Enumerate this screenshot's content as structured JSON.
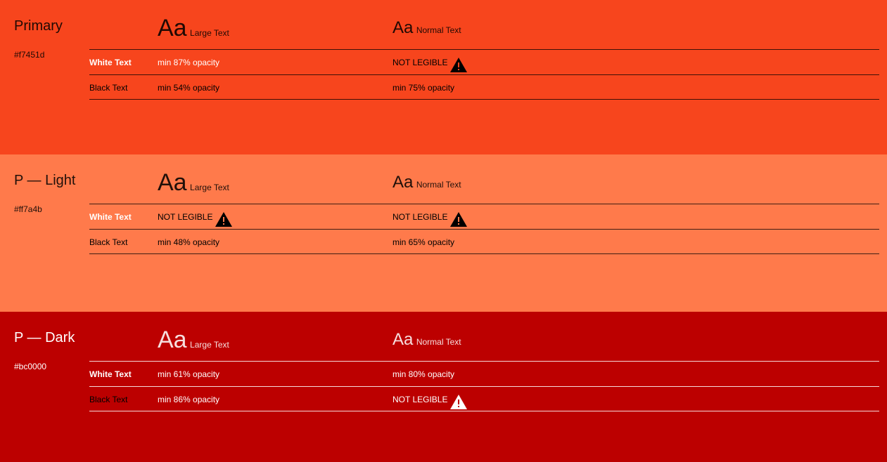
{
  "palette": [
    {
      "name": "Primary",
      "hex": "#f7451d",
      "bg": "#f7451d",
      "large_sample": "Aa",
      "large_label": "Large Text",
      "normal_sample": "Aa",
      "normal_label": "Normal Text",
      "white_row": {
        "label": "White Text",
        "large": "min 87% opacity",
        "normal": "NOT LEGIBLE",
        "normal_warn": true
      },
      "black_row": {
        "label": "Black Text",
        "large": "min 54% opacity",
        "normal": "min 75% opacity"
      }
    },
    {
      "name": "P — Light",
      "hex": "#ff7a4b",
      "bg": "#ff7a4b",
      "large_sample": "Aa",
      "large_label": "Large Text",
      "normal_sample": "Aa",
      "normal_label": "Normal Text",
      "white_row": {
        "label": "White Text",
        "large": "NOT LEGIBLE",
        "large_warn": true,
        "normal": "NOT LEGIBLE",
        "normal_warn": true
      },
      "black_row": {
        "label": "Black Text",
        "large": "min 48% opacity",
        "normal": "min 65% opacity"
      }
    },
    {
      "name": "P — Dark",
      "hex": "#bc0000",
      "bg": "#bc0000",
      "large_sample": "Aa",
      "large_label": "Large Text",
      "normal_sample": "Aa",
      "normal_label": "Normal Text",
      "white_row": {
        "label": "White Text",
        "large": "min 61% opacity",
        "normal": "min 80% opacity"
      },
      "black_row": {
        "label": "Black Text",
        "large": "min 86% opacity",
        "normal": "NOT LEGIBLE",
        "normal_warn": true
      }
    }
  ]
}
